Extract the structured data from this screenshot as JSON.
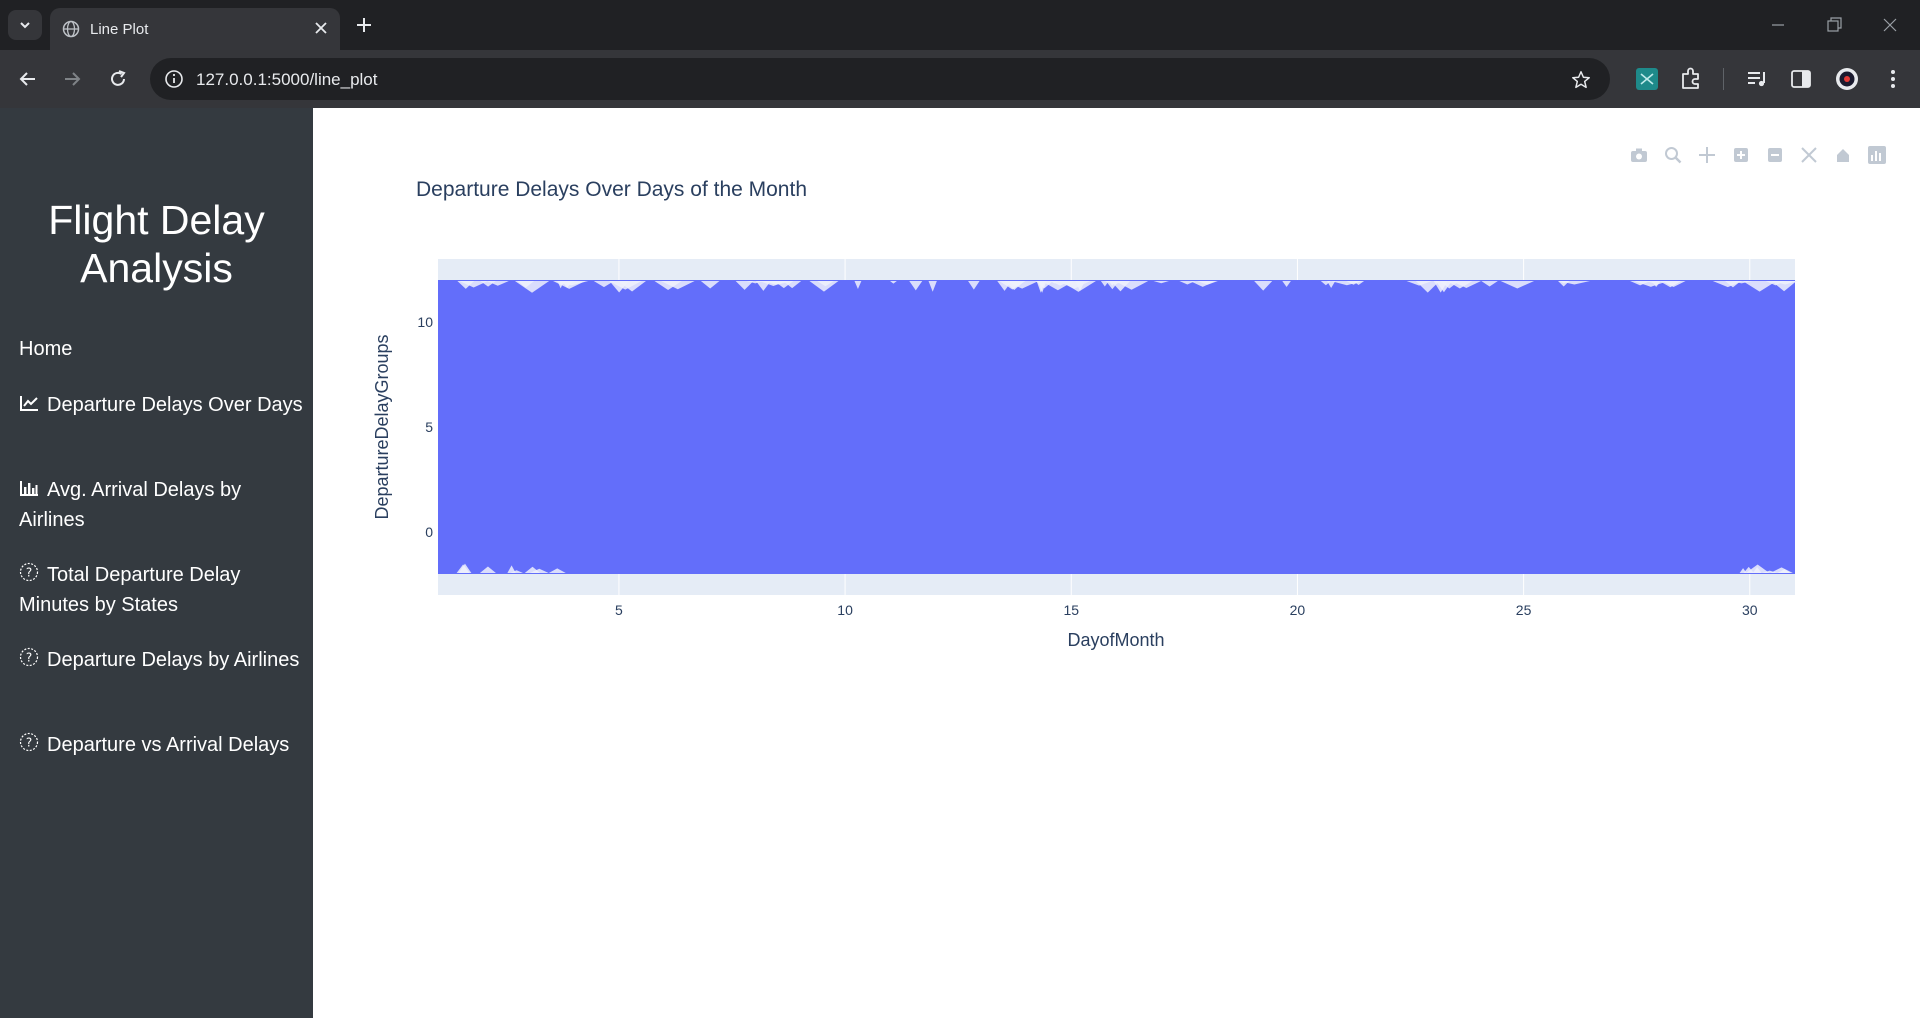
{
  "browser": {
    "tab_title": "Line Plot",
    "url": "127.0.0.1:5000/line_plot"
  },
  "sidebar": {
    "title": "Flight Delay Analysis",
    "items": [
      {
        "label": "Home",
        "icon": "none"
      },
      {
        "label": "Departure Delays Over Days",
        "icon": "line-chart-icon"
      },
      {
        "label": "Avg. Arrival Delays by Airlines",
        "icon": "bar-chart-icon"
      },
      {
        "label": "Total Departure Delay Minutes by States",
        "icon": "question-circle-icon"
      },
      {
        "label": "Departure Delays by Airlines",
        "icon": "question-circle-icon"
      },
      {
        "label": "Departure vs Arrival Delays",
        "icon": "question-circle-icon"
      }
    ]
  },
  "colors": {
    "sidebar_bg": "#343a40",
    "plot_bg": "#e5ecf6",
    "series": "#636efa",
    "title_text": "#2a3f5f"
  },
  "chart_data": {
    "type": "line",
    "title": "Departure Delays Over Days of the Month",
    "xlabel": "DayofMonth",
    "ylabel": "DepartureDelayGroups",
    "xlim": [
      1,
      31
    ],
    "ylim": [
      -3,
      13
    ],
    "x_ticks": [
      5,
      10,
      15,
      20,
      25,
      30
    ],
    "y_ticks": [
      0,
      5,
      10
    ],
    "series": [
      {
        "name": "",
        "x_range": [
          1,
          31
        ],
        "y_range": [
          -2,
          12
        ]
      }
    ],
    "grid": true,
    "legend": "none"
  }
}
